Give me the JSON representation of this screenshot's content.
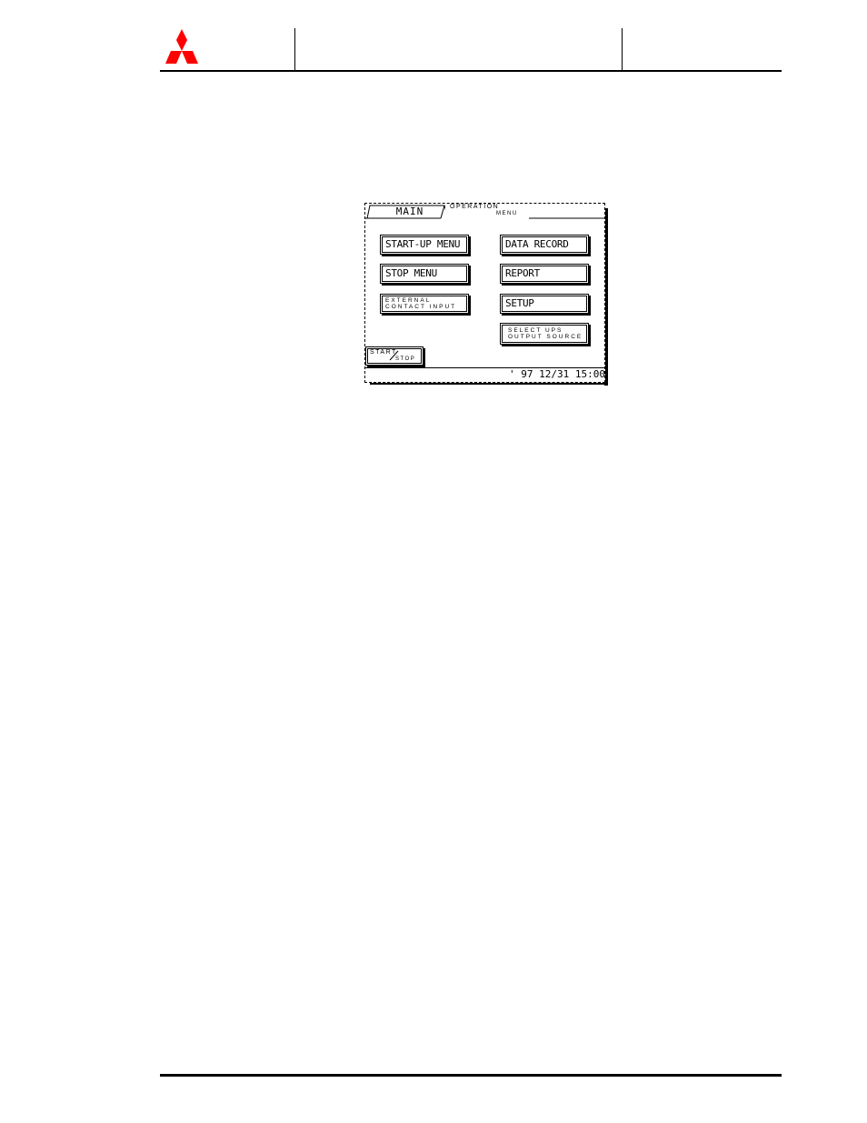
{
  "header": {
    "logo": "mitsubishi-three-diamonds-logo",
    "logo_color": "#ff0000"
  },
  "screen": {
    "tabs": [
      {
        "label": "MAIN",
        "active": false
      },
      {
        "label_line1": "OPERATION",
        "label_line2": "MENU",
        "active": true
      }
    ],
    "buttons": {
      "startup_menu": "START-UP MENU",
      "stop_menu": "STOP MENU",
      "external_contact_input_line1": "EXTERNAL",
      "external_contact_input_line2": "CONTACT INPUT",
      "data_record": "DATA RECORD",
      "report": "REPORT",
      "setup": "SETUP",
      "select_ups_line1": "SELECT UPS",
      "select_ups_line2": "OUTPUT SOURCE",
      "start_stop_line1": "START",
      "start_stop_line2": "STOP"
    },
    "status": {
      "datetime": "' 97 12/31 15:00"
    }
  }
}
